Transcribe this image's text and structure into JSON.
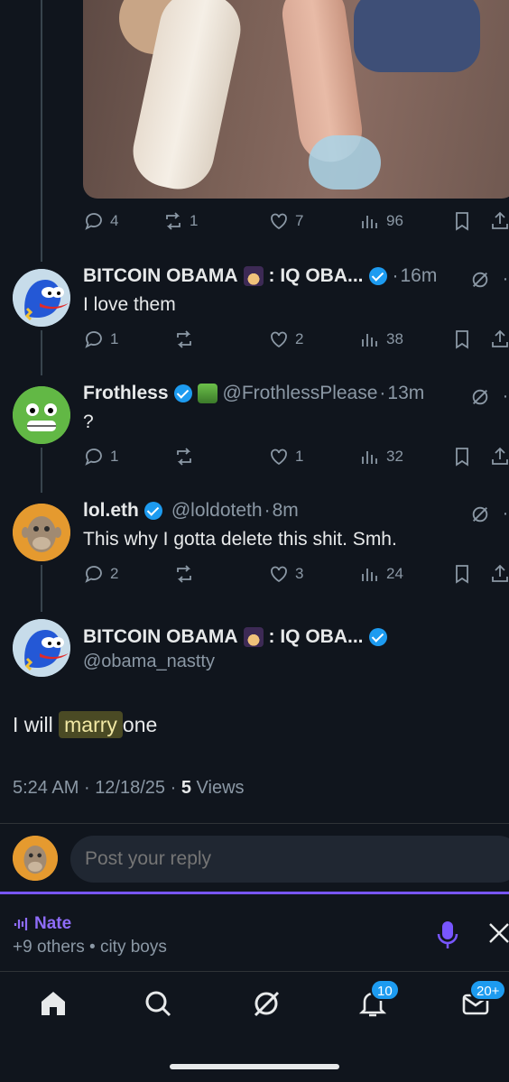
{
  "top_post": {
    "stats": {
      "replies": "4",
      "reposts": "1",
      "likes": "7",
      "views": "96"
    }
  },
  "replies": [
    {
      "name": "BITCOIN OBAMA",
      "suffix": ": IQ OBA...",
      "handle": "",
      "time": "16m",
      "text": "I love them",
      "stats": {
        "replies": "1",
        "reposts": "",
        "likes": "2",
        "views": "38"
      }
    },
    {
      "name": "Frothless",
      "suffix": "",
      "handle": "@FrothlessPlease",
      "time": "13m",
      "text": "?",
      "stats": {
        "replies": "1",
        "reposts": "",
        "likes": "1",
        "views": "32"
      }
    },
    {
      "name": "lol.eth",
      "suffix": "",
      "handle": "@loldoteth",
      "time": "8m",
      "text": "This why I gotta delete this shit. Smh.",
      "stats": {
        "replies": "2",
        "reposts": "",
        "likes": "3",
        "views": "24"
      }
    }
  ],
  "main_post": {
    "name": "BITCOIN OBAMA",
    "suffix": ": IQ OBA...",
    "handle": "@obama_nastty",
    "text_before": "I will",
    "text_highlight": "marry",
    "text_after": "one",
    "time": "5:24 AM",
    "date": "12/18/25",
    "views_count": "5",
    "views_label": "Views"
  },
  "reply_bar": {
    "placeholder": "Post your reply"
  },
  "space": {
    "host": "Nate",
    "subtitle": "+9 others • city boys"
  },
  "tabs": {
    "notifications_badge": "10",
    "messages_badge": "20+"
  },
  "separators": {
    "dot": "·"
  },
  "icons": [
    "comment-icon",
    "repost-icon",
    "heart-icon",
    "views-icon",
    "bookmark-icon",
    "share-icon",
    "grok-icon",
    "more-icon",
    "home-icon",
    "search-icon",
    "bell-icon",
    "mail-icon",
    "mic-icon",
    "close-icon"
  ],
  "colors": {
    "accent": "#1d9bf0",
    "spaces": "#7856ff",
    "background": "#10151d"
  }
}
